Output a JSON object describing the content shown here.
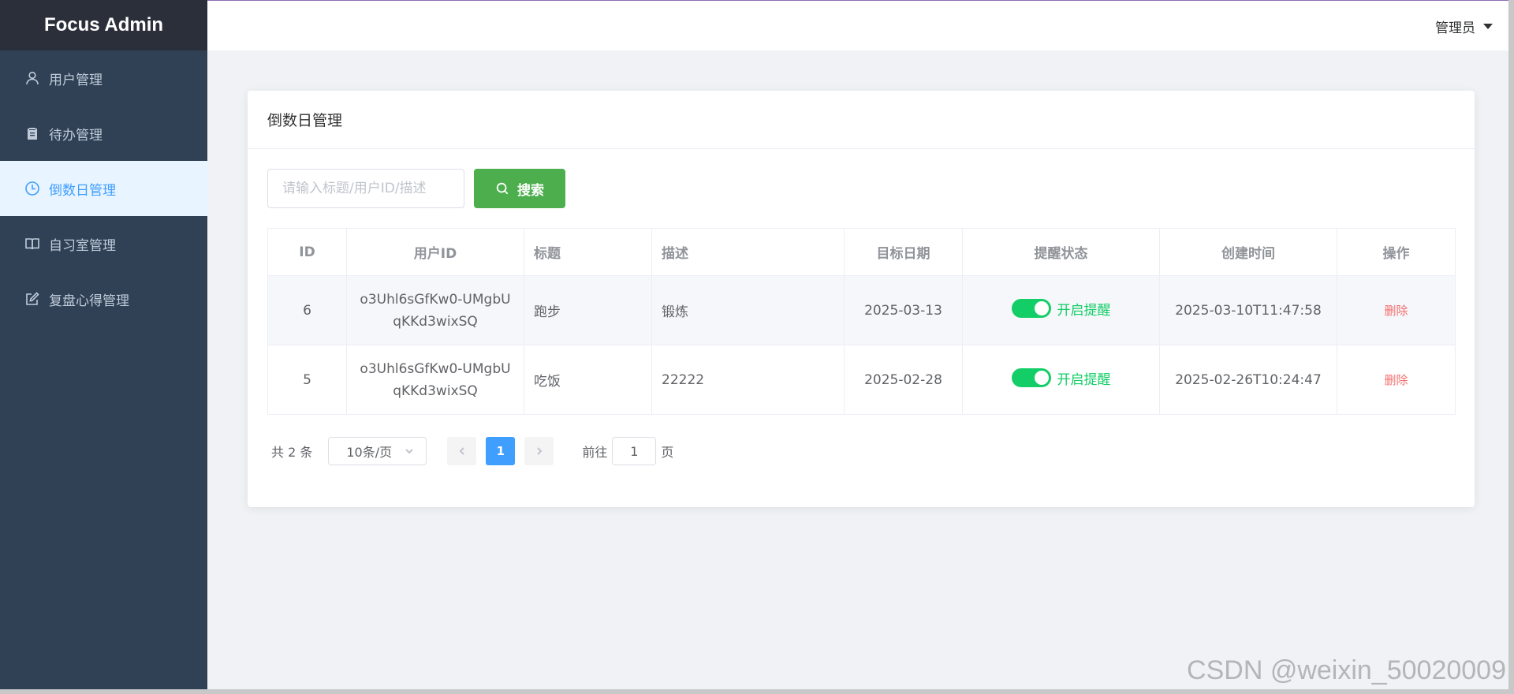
{
  "brand": "Focus Admin",
  "sidebar": {
    "items": [
      {
        "label": "用户管理",
        "icon": "user-icon",
        "active": false
      },
      {
        "label": "待办管理",
        "icon": "clipboard-icon",
        "active": false
      },
      {
        "label": "倒数日管理",
        "icon": "clock-icon",
        "active": true
      },
      {
        "label": "自习室管理",
        "icon": "book-icon",
        "active": false
      },
      {
        "label": "复盘心得管理",
        "icon": "edit-icon",
        "active": false
      }
    ]
  },
  "header": {
    "user": "管理员"
  },
  "card": {
    "title": "倒数日管理"
  },
  "search": {
    "placeholder": "请输入标题/用户ID/描述",
    "button": "搜索"
  },
  "table": {
    "columns": [
      "ID",
      "用户ID",
      "标题",
      "描述",
      "目标日期",
      "提醒状态",
      "创建时间",
      "操作"
    ],
    "rows": [
      {
        "id": "6",
        "user_id": "o3Uhl6sGfKw0-UMgbUqKKd3wixSQ",
        "title": "跑步",
        "desc": "锻炼",
        "target_date": "2025-03-13",
        "remind": "开启提醒",
        "created": "2025-03-10T11:47:58",
        "action": "删除"
      },
      {
        "id": "5",
        "user_id": "o3Uhl6sGfKw0-UMgbUqKKd3wixSQ",
        "title": "吃饭",
        "desc": "22222",
        "target_date": "2025-02-28",
        "remind": "开启提醒",
        "created": "2025-02-26T10:24:47",
        "action": "删除"
      }
    ]
  },
  "pagination": {
    "total": "共 2 条",
    "page_size": "10条/页",
    "current": "1",
    "goto_prefix": "前往",
    "goto_value": "1",
    "goto_suffix": "页"
  },
  "watermark": "CSDN @weixin_50020009",
  "colors": {
    "sidebar": "#304156",
    "active": "#409eff",
    "search_button": "#4cae4c",
    "switch_on": "#13ce66",
    "delete": "#f56c6c"
  }
}
